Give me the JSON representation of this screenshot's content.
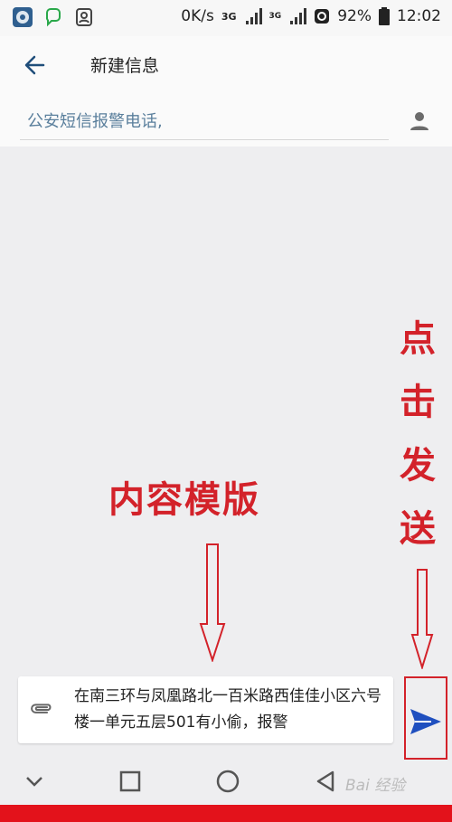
{
  "status_bar": {
    "speed": "0K/s",
    "network": "3G",
    "network_small": "3G",
    "battery": "92%",
    "time": "12:02"
  },
  "app_bar": {
    "title": "新建信息",
    "back_icon": "arrow-left-icon"
  },
  "recipient": {
    "value": "公安短信报警电话,",
    "contact_icon": "person-icon"
  },
  "compose": {
    "text": "在南三环与凤凰路北一百米路西佳佳小区六号楼一单元五层501有小偷，报警",
    "attach_icon": "paperclip-icon",
    "send_icon": "send-icon"
  },
  "annotations": {
    "template_label": "内容模版",
    "send_label": [
      "点",
      "击",
      "发",
      "送"
    ],
    "color": "#d3222a"
  },
  "nav_bar": {
    "icons": [
      "chevron-down-icon",
      "square-icon",
      "circle-icon",
      "triangle-back-icon"
    ],
    "watermark": "Bai 经验"
  }
}
